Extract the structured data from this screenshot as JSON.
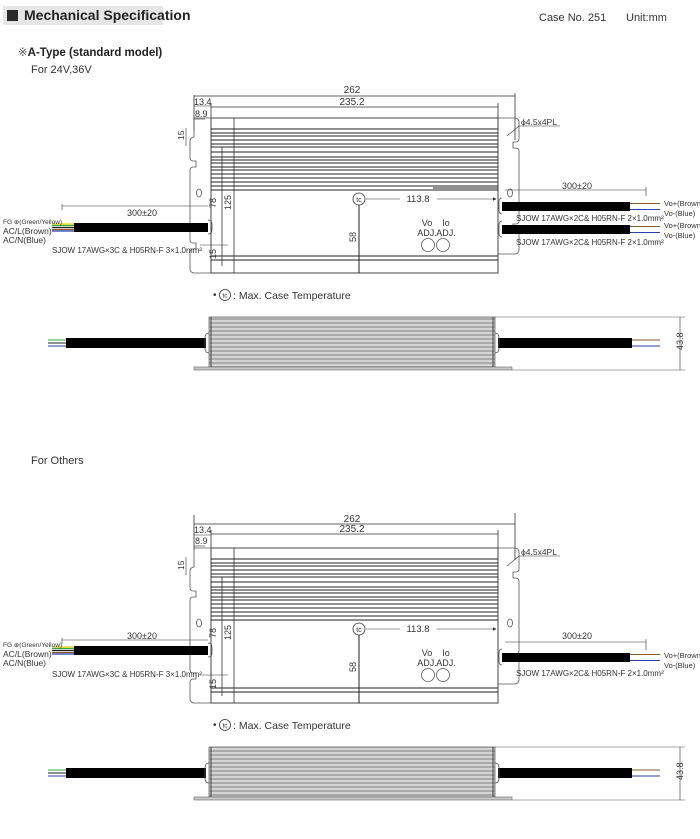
{
  "header": {
    "title": "Mechanical Specification",
    "case_no": "Case No. 251",
    "unit": "Unit:mm"
  },
  "model": {
    "symbol": "※",
    "label": "A-Type (standard model)"
  },
  "sections": [
    {
      "heading": "For 24V,36V",
      "dims": {
        "overall_length": "262",
        "body_length": "235.2",
        "offset_a": "13.4",
        "offset_b": "8.9",
        "slot": "15",
        "height_mount": "78",
        "height_overall": "125",
        "bottom_offset": "15",
        "tc_height": "58",
        "tc_distance": "113.8",
        "mount_hole": "ϕ4.5x4PL",
        "side_height": "43.8"
      },
      "input": {
        "fg_label": "FG",
        "fg_colors": "(Green/Yellow)",
        "acl": "AC/L(Brown)",
        "acn": "AC/N(Blue)",
        "length": "300±20",
        "cable_spec": "SJOW 17AWG×3C & H05RN-F 3×1.0mm²"
      },
      "outputs": {
        "length": "300±20",
        "cables": [
          {
            "spec": "SJOW 17AWG×2C& H05RN-F 2×1.0mm²",
            "pos": "Vo+(Brown)",
            "neg": "Vo-(Blue)"
          },
          {
            "spec": "SJOW 17AWG×2C& H05RN-F 2×1.0mm²",
            "pos": "Vo+(Brown)",
            "neg": "Vo-(Blue)"
          }
        ]
      },
      "adjust": {
        "vo_top": "Vo",
        "vo_bottom": "ADJ.",
        "io_top": "Io",
        "io_bottom": "ADJ."
      },
      "tc_symbol": "tc",
      "legend": {
        "bullet": "•",
        "symbol": "tc",
        "text": ": Max. Case Temperature"
      }
    },
    {
      "heading": "For Others",
      "dims": {
        "overall_length": "262",
        "body_length": "235.2",
        "offset_a": "13.4",
        "offset_b": "8.9",
        "slot": "15",
        "height_mount": "78",
        "height_overall": "125",
        "bottom_offset": "15",
        "tc_height": "58",
        "tc_distance": "113.8",
        "mount_hole": "ϕ4.5x4PL",
        "side_height": "43.8"
      },
      "input": {
        "fg_label": "FG",
        "fg_colors": "(Green/Yellow)",
        "acl": "AC/L(Brown)",
        "acn": "AC/N(Blue)",
        "length": "300±20",
        "cable_spec": "SJOW 17AWG×3C & H05RN-F 3×1.0mm²"
      },
      "outputs": {
        "length": "300±20",
        "cables": [
          {
            "spec": "SJOW 17AWG×2C& H05RN-F 2×1.0mm²",
            "pos": "Vo+(Brown)",
            "neg": "Vo-(Blue)"
          }
        ]
      },
      "adjust": {
        "vo_top": "Vo",
        "vo_bottom": "ADJ.",
        "io_top": "Io",
        "io_bottom": "ADJ."
      },
      "tc_symbol": "tc",
      "legend": {
        "bullet": "•",
        "symbol": "tc",
        "text": ": Max. Case Temperature"
      }
    }
  ],
  "colors": {
    "header_bg": "#e6e6e6",
    "line": "#333333",
    "cable": "#000000",
    "wire_brown": "#8b5a2b",
    "wire_blue": "#2a3fb0",
    "wire_green": "#3aa63a",
    "wire_yellow": "#e6d400",
    "side_fin_light": "#c8c8c8",
    "side_fin_dark": "#8a8a8a"
  }
}
